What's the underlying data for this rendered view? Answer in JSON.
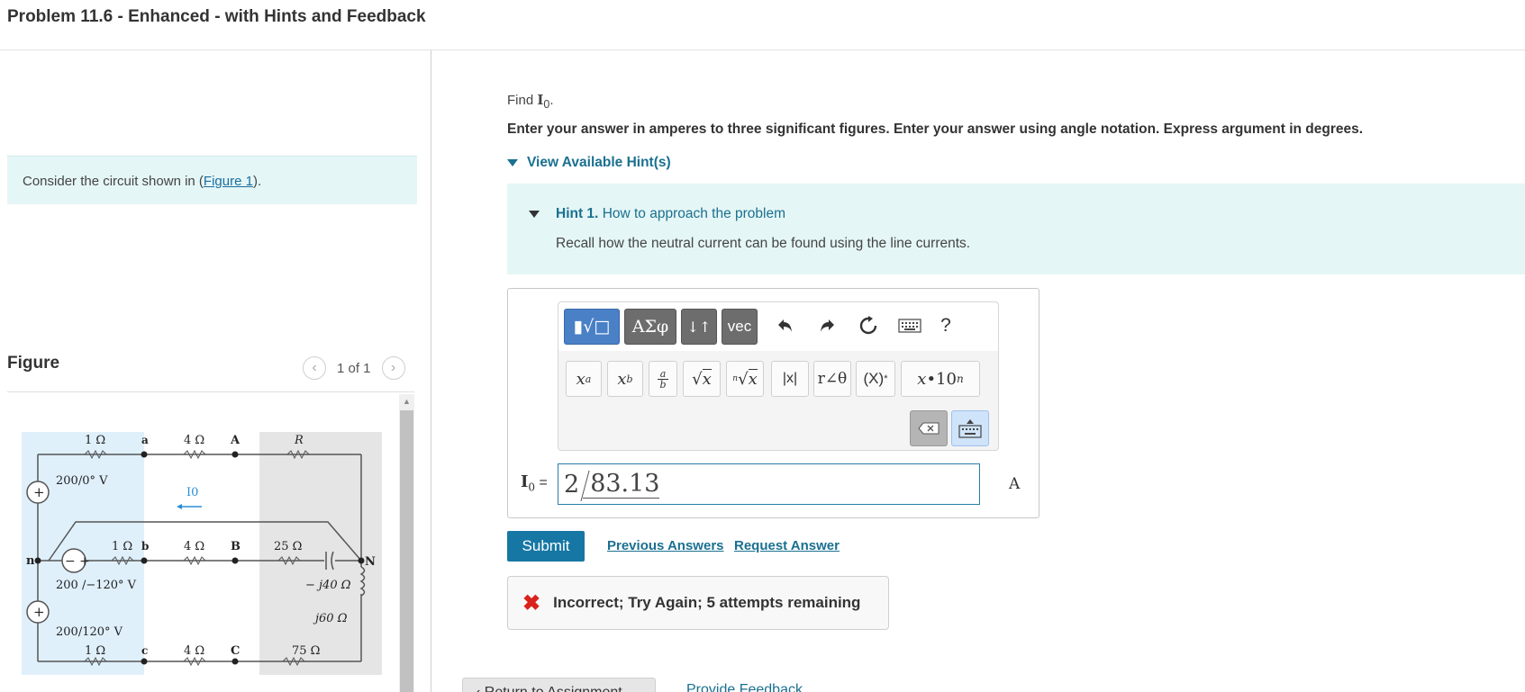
{
  "page_title": "Problem 11.6 - Enhanced - with Hints and Feedback",
  "intro": {
    "text_before": "Consider the circuit shown in (",
    "figure_link": "Figure 1",
    "text_after": ")."
  },
  "figure": {
    "heading": "Figure",
    "counter": "1 of 1",
    "prev_icon": "chevron-left-icon",
    "next_icon": "chevron-right-icon",
    "circuit_labels": {
      "r1a": "1 Ω",
      "node_a": "a",
      "r4a": "4 Ω",
      "node_A": "A",
      "rR": "R",
      "src_a": "200/0° V",
      "io": "I0",
      "node_n": "n",
      "r1b": "1 Ω",
      "node_b": "b",
      "r4b": "4 Ω",
      "node_B": "B",
      "r25": "25 Ω",
      "node_N": "N",
      "src_b": "200 /−120° V",
      "cap": "− j40 Ω",
      "ind": "j60 Ω",
      "src_c": "200/120° V",
      "r1c": "1 Ω",
      "node_c": "c",
      "r4c": "4 Ω",
      "node_C": "C",
      "r75": "75 Ω"
    }
  },
  "question": {
    "find_prefix": "Find ",
    "find_var": "I",
    "find_sub": "0",
    "find_suffix": ".",
    "instructions": "Enter your answer in amperes to three significant figures. Enter your answer using angle notation. Express argument in degrees.",
    "view_hints": "View Available Hint(s)"
  },
  "hint": {
    "number": "Hint 1.",
    "title": "How to approach the problem",
    "body": "Recall how the neutral current can be found using the line currents."
  },
  "toolbar": {
    "templates": "▮√□",
    "greek": "ΑΣφ",
    "arrows": "↓↑",
    "vec": "vec",
    "help": "?",
    "symbols": [
      "xᵃ",
      "x_b",
      "a/b",
      "√x",
      "ⁿ√x",
      "|x|",
      "r∠θ",
      "(X)*",
      "x·10ⁿ"
    ]
  },
  "answer": {
    "var": "I",
    "sub": "0",
    "eq": " =",
    "magnitude": "2",
    "angle": "83.13",
    "units": "A"
  },
  "actions": {
    "submit": "Submit",
    "previous_answers": "Previous Answers",
    "request_answer": "Request Answer"
  },
  "feedback": {
    "icon": "x-icon",
    "message": "Incorrect; Try Again; 5 attempts remaining"
  },
  "footer": {
    "return": "Return to Assignment",
    "provide_feedback": "Provide Feedback"
  }
}
